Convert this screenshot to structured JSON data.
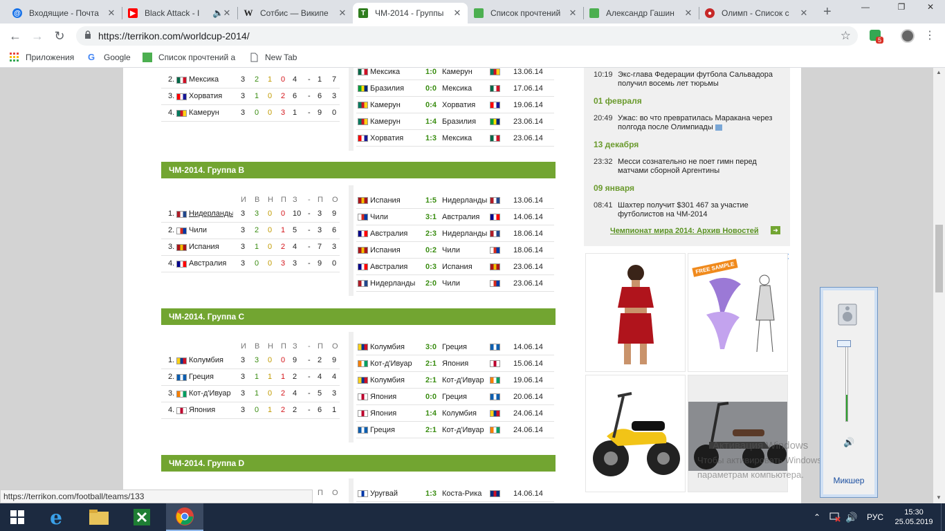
{
  "tabs": [
    {
      "title": "Входящие - Почта",
      "icon": "mail-icon",
      "active": false
    },
    {
      "title": "Black Attack - I",
      "icon": "youtube-icon",
      "active": false
    },
    {
      "title": "Сотбис — Википе",
      "icon": "wikipedia-icon",
      "active": false
    },
    {
      "title": "ЧМ-2014 - Группы",
      "icon": "terrikon-icon",
      "active": true
    },
    {
      "title": "Список прочтений",
      "icon": "green-square-icon",
      "active": false
    },
    {
      "title": "Александр Гашин",
      "icon": "green-square-icon",
      "active": false
    },
    {
      "title": "Олимп - Список с",
      "icon": "olimp-icon",
      "active": false
    }
  ],
  "address": {
    "url": "https://terrikon.com/worldcup-2014/"
  },
  "extension_badge": "5",
  "bookmarks": [
    {
      "label": "Приложения",
      "icon": "apps-grid-icon"
    },
    {
      "label": "Google",
      "icon": "google-icon"
    },
    {
      "label": "Список прочтений a",
      "icon": "green-square-icon"
    },
    {
      "label": "New Tab",
      "icon": "page-icon"
    }
  ],
  "groupA": {
    "standings": [
      {
        "pos": "2.",
        "team": "Мексика",
        "flag": "mx",
        "i": "3",
        "w": "2",
        "d": "1",
        "l": "0",
        "gf": "4",
        "dash": "-",
        "ga": "1",
        "p": "7"
      },
      {
        "pos": "3.",
        "team": "Хорватия",
        "flag": "hr",
        "i": "3",
        "w": "1",
        "d": "0",
        "l": "2",
        "gf": "6",
        "dash": "-",
        "ga": "6",
        "p": "3"
      },
      {
        "pos": "4.",
        "team": "Камерун",
        "flag": "cm",
        "i": "3",
        "w": "0",
        "d": "0",
        "l": "3",
        "gf": "1",
        "dash": "-",
        "ga": "9",
        "p": "0"
      }
    ],
    "matches": [
      {
        "t1": "Мексика",
        "f1": "mx",
        "score": "1:0",
        "t2": "Камерун",
        "f2": "cm",
        "date": "13.06.14"
      },
      {
        "t1": "Бразилия",
        "f1": "br",
        "score": "0:0",
        "t2": "Мексика",
        "f2": "mx",
        "date": "17.06.14"
      },
      {
        "t1": "Камерун",
        "f1": "cm",
        "score": "0:4",
        "t2": "Хорватия",
        "f2": "hr",
        "date": "19.06.14"
      },
      {
        "t1": "Камерун",
        "f1": "cm",
        "score": "1:4",
        "t2": "Бразилия",
        "f2": "br",
        "date": "23.06.14"
      },
      {
        "t1": "Хорватия",
        "f1": "hr",
        "score": "1:3",
        "t2": "Мексика",
        "f2": "mx",
        "date": "23.06.14"
      }
    ]
  },
  "col_headers": {
    "i": "И",
    "w": "В",
    "d": "Н",
    "l": "П",
    "gf": "З",
    "dash": "-",
    "ga": "П",
    "p": "О"
  },
  "groupB": {
    "title": "ЧМ-2014. Группа B",
    "standings": [
      {
        "pos": "1.",
        "team": "Нидерланды",
        "flag": "nl",
        "i": "3",
        "w": "3",
        "d": "0",
        "l": "0",
        "gf": "10",
        "dash": "-",
        "ga": "3",
        "p": "9"
      },
      {
        "pos": "2.",
        "team": "Чили",
        "flag": "cl",
        "i": "3",
        "w": "2",
        "d": "0",
        "l": "1",
        "gf": "5",
        "dash": "-",
        "ga": "3",
        "p": "6"
      },
      {
        "pos": "3.",
        "team": "Испания",
        "flag": "es",
        "i": "3",
        "w": "1",
        "d": "0",
        "l": "2",
        "gf": "4",
        "dash": "-",
        "ga": "7",
        "p": "3"
      },
      {
        "pos": "4.",
        "team": "Австралия",
        "flag": "au",
        "i": "3",
        "w": "0",
        "d": "0",
        "l": "3",
        "gf": "3",
        "dash": "-",
        "ga": "9",
        "p": "0"
      }
    ],
    "matches": [
      {
        "t1": "Испания",
        "f1": "es",
        "score": "1:5",
        "t2": "Нидерланды",
        "f2": "nl",
        "date": "13.06.14"
      },
      {
        "t1": "Чили",
        "f1": "cl",
        "score": "3:1",
        "t2": "Австралия",
        "f2": "au",
        "date": "14.06.14"
      },
      {
        "t1": "Австралия",
        "f1": "au",
        "score": "2:3",
        "t2": "Нидерланды",
        "f2": "nl",
        "date": "18.06.14"
      },
      {
        "t1": "Испания",
        "f1": "es",
        "score": "0:2",
        "t2": "Чили",
        "f2": "cl",
        "date": "18.06.14"
      },
      {
        "t1": "Австралия",
        "f1": "au",
        "score": "0:3",
        "t2": "Испания",
        "f2": "es",
        "date": "23.06.14"
      },
      {
        "t1": "Нидерланды",
        "f1": "nl",
        "score": "2:0",
        "t2": "Чили",
        "f2": "cl",
        "date": "23.06.14"
      }
    ]
  },
  "groupC": {
    "title": "ЧМ-2014. Группа C",
    "standings": [
      {
        "pos": "1.",
        "team": "Колумбия",
        "flag": "co",
        "i": "3",
        "w": "3",
        "d": "0",
        "l": "0",
        "gf": "9",
        "dash": "-",
        "ga": "2",
        "p": "9"
      },
      {
        "pos": "2.",
        "team": "Греция",
        "flag": "gr",
        "i": "3",
        "w": "1",
        "d": "1",
        "l": "1",
        "gf": "2",
        "dash": "-",
        "ga": "4",
        "p": "4"
      },
      {
        "pos": "3.",
        "team": "Кот-д'Ивуар",
        "flag": "ci",
        "i": "3",
        "w": "1",
        "d": "0",
        "l": "2",
        "gf": "4",
        "dash": "-",
        "ga": "5",
        "p": "3"
      },
      {
        "pos": "4.",
        "team": "Япония",
        "flag": "jp",
        "i": "3",
        "w": "0",
        "d": "1",
        "l": "2",
        "gf": "2",
        "dash": "-",
        "ga": "6",
        "p": "1"
      }
    ],
    "matches": [
      {
        "t1": "Колумбия",
        "f1": "co",
        "score": "3:0",
        "t2": "Греция",
        "f2": "gr",
        "date": "14.06.14"
      },
      {
        "t1": "Кот-д'Ивуар",
        "f1": "ci",
        "score": "2:1",
        "t2": "Япония",
        "f2": "jp",
        "date": "15.06.14"
      },
      {
        "t1": "Колумбия",
        "f1": "co",
        "score": "2:1",
        "t2": "Кот-д'Ивуар",
        "f2": "ci",
        "date": "19.06.14"
      },
      {
        "t1": "Япония",
        "f1": "jp",
        "score": "0:0",
        "t2": "Греция",
        "f2": "gr",
        "date": "20.06.14"
      },
      {
        "t1": "Япония",
        "f1": "jp",
        "score": "1:4",
        "t2": "Колумбия",
        "f2": "co",
        "date": "24.06.14"
      },
      {
        "t1": "Греция",
        "f1": "gr",
        "score": "2:1",
        "t2": "Кот-д'Ивуар",
        "f2": "ci",
        "date": "24.06.14"
      }
    ]
  },
  "groupD": {
    "title": "ЧМ-2014. Группа D",
    "header_tail": {
      "ga": "П",
      "p": "О"
    },
    "first_match": {
      "t1": "Уругвай",
      "f1": "uy",
      "score": "1:3",
      "t2": "Коста-Рика",
      "f2": "cr",
      "date": "14.06.14"
    }
  },
  "news": {
    "items": [
      {
        "time": "10:19",
        "text": "Экс-глава Федерации футбола Сальвадора получил восемь лет тюрьмы"
      },
      {
        "date": "01 февраля"
      },
      {
        "time": "20:49",
        "text": "Ужас: во что превратилась Маракана через полгода после Олимпиады"
      },
      {
        "date": "13 декабря"
      },
      {
        "time": "23:32",
        "text": "Месси сознательно не поет гимн перед матчами сборной Аргентины"
      },
      {
        "date": "09 января"
      },
      {
        "time": "08:41",
        "text": "Шахтер получит $301 467 за участие футболистов на ЧМ-2014"
      }
    ],
    "archive_link": "Чемпионат мира 2014: Архив Новостей"
  },
  "ads": {
    "free_sample": "FREE SAMPLE"
  },
  "volume": {
    "level_fraction": 0.35,
    "mixer_label": "Микшер"
  },
  "watermark": {
    "line1": "Активация Windows",
    "line2": "Чтобы активировать Windows, перейдите к",
    "line3": "параметрам компьютера."
  },
  "status_url": "https://terrikon.com/football/teams/133",
  "taskbar": {
    "lang": "РУС",
    "time": "15:30",
    "date": "25.05.2019"
  },
  "flag_colors": {
    "mx": [
      "#006847",
      "#ffffff",
      "#ce1126"
    ],
    "hr": [
      "#ff0000",
      "#ffffff",
      "#171796"
    ],
    "cm": [
      "#007a5e",
      "#ce1126",
      "#fcd116"
    ],
    "br": [
      "#009c3b",
      "#ffdf00",
      "#002776"
    ],
    "nl": [
      "#ae1c28",
      "#ffffff",
      "#21468b"
    ],
    "cl": [
      "#ffffff",
      "#d52b1e",
      "#0039a6"
    ],
    "es": [
      "#aa151b",
      "#f1bf00",
      "#aa151b"
    ],
    "au": [
      "#00008b",
      "#ffffff",
      "#ff0000"
    ],
    "co": [
      "#fcd116",
      "#003893",
      "#ce1126"
    ],
    "gr": [
      "#0d5eaf",
      "#ffffff",
      "#0d5eaf"
    ],
    "ci": [
      "#f77f00",
      "#ffffff",
      "#009e60"
    ],
    "jp": [
      "#ffffff",
      "#bc002d",
      "#ffffff"
    ],
    "uy": [
      "#ffffff",
      "#0038a8",
      "#ffffff"
    ],
    "cr": [
      "#002b7f",
      "#ce1126",
      "#002b7f"
    ]
  }
}
